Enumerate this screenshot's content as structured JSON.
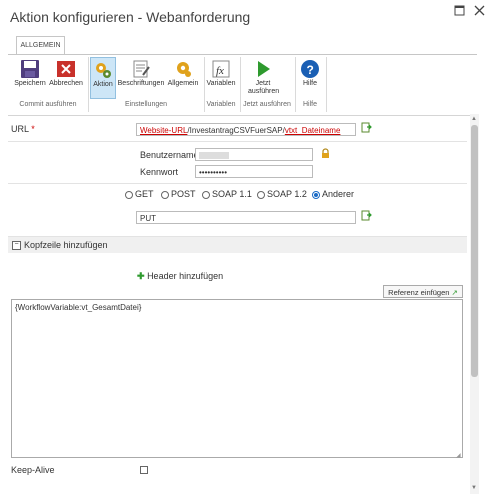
{
  "window": {
    "title": "Aktion konfigurieren - Webanforderung"
  },
  "ribbon": {
    "tab": "ALLGEMEIN",
    "buttons": {
      "save": "Speichern",
      "cancel": "Abbrechen",
      "action": "Aktion",
      "labels": "Beschriftungen",
      "general": "Allgemein",
      "variables": "Variablen",
      "run_now": "Jetzt ausführen",
      "help": "Hilfe"
    },
    "groups": {
      "commit": "Commit ausführen",
      "settings": "Einstellungen",
      "variables": "Variablen",
      "run_now": "Jetzt ausführen",
      "help": "Hilfe"
    }
  },
  "form": {
    "url_label": "URL",
    "url_required": "*",
    "url_part1": "Website-URL",
    "url_part2": "/InvestantragCSVFuerSAP/",
    "url_part3": "vtxt_Dateiname",
    "username_label": "Benutzername",
    "password_label": "Kennwort",
    "password_value": "••••••••••",
    "methods": [
      "GET",
      "POST",
      "SOAP 1.1",
      "SOAP 1.2",
      "Anderer"
    ],
    "selected_method": "Anderer",
    "method_value": "PUT",
    "headers_section": "Kopfzeile hinzufügen",
    "add_header": "Header hinzufügen",
    "insert_reference": "Referenz einfügen",
    "body_value": "{WorkflowVariable:vt_GesamtDatei}",
    "keepalive_label": "Keep-Alive"
  }
}
